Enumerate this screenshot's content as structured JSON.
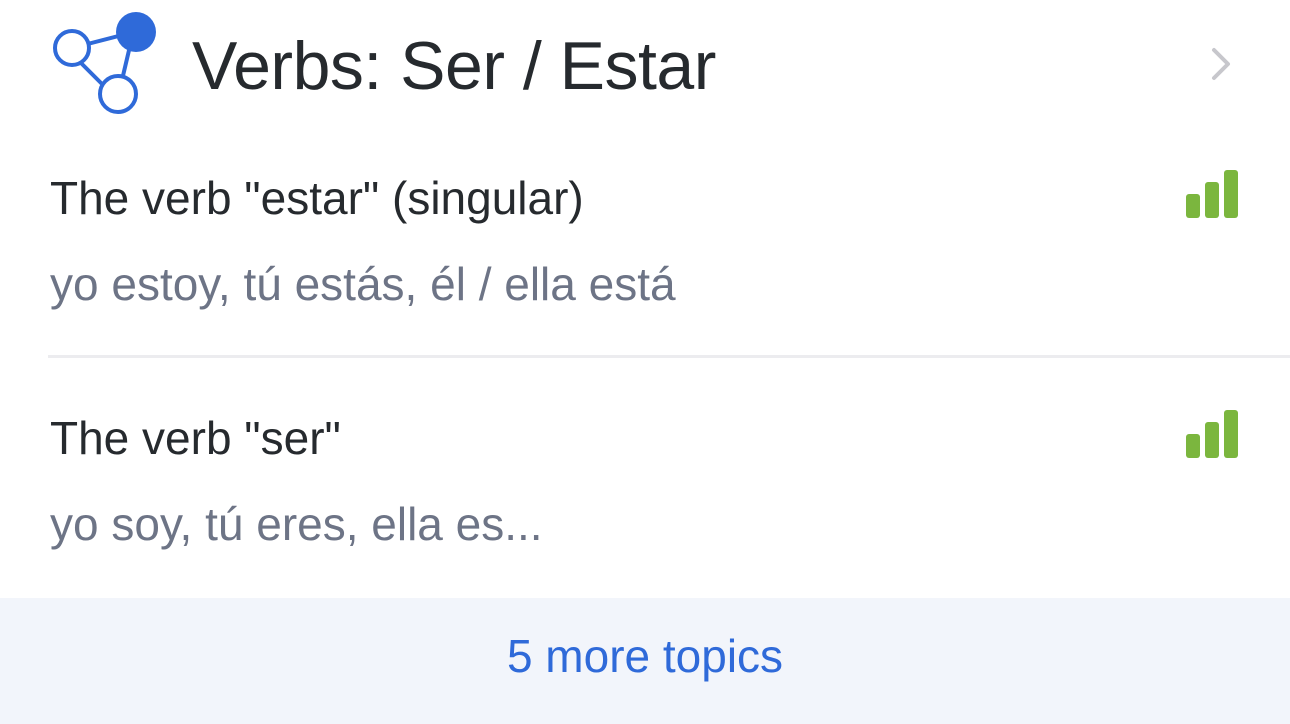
{
  "header": {
    "title": "Verbs: Ser / Estar",
    "icon": "skill-graph-icon",
    "chevron_icon": "chevron-right-icon"
  },
  "topics": [
    {
      "title": "The verb \"estar\" (singular)",
      "subtitle": "yo estoy, tú estás, él / ella está",
      "level_icon": "level-bars-icon",
      "level": 3,
      "level_max": 3
    },
    {
      "title": "The verb \"ser\"",
      "subtitle": "yo soy, tú eres, ella es...",
      "level_icon": "level-bars-icon",
      "level": 3,
      "level_max": 3
    }
  ],
  "footer": {
    "more_label": "5 more topics"
  },
  "colors": {
    "title_text": "#262a2e",
    "subtitle_text": "#6d7486",
    "accent_blue": "#2f6ad9",
    "level_green": "#7bb63e",
    "footer_bg": "#f2f5fb",
    "chevron_gray": "#c7c7cc",
    "divider": "#ececef"
  }
}
